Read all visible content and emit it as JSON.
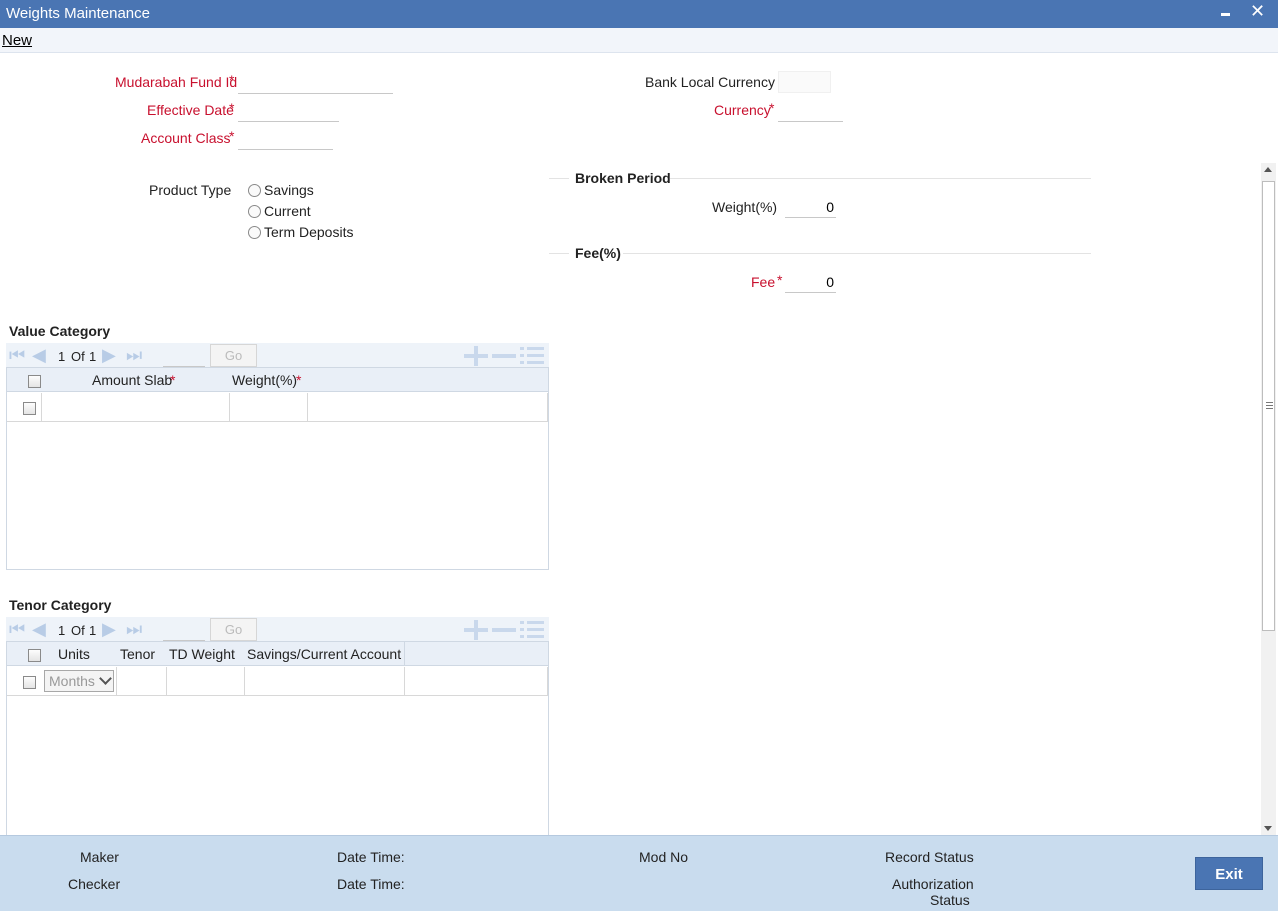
{
  "window": {
    "title": "Weights Maintenance"
  },
  "menu": {
    "new_label": "New"
  },
  "form": {
    "fund_id_label": "Mudarabah Fund Id",
    "effective_date_label": "Effective Date",
    "account_class_label": "Account Class",
    "bank_local_currency_label": "Bank Local Currency",
    "currency_label": "Currency",
    "required_mark": "*",
    "product_type_label": "Product Type",
    "product_types": [
      "Savings",
      "Current",
      "Term Deposits"
    ]
  },
  "broken_period": {
    "title": "Broken Period",
    "weight_label": "Weight(%)",
    "weight_value": "0"
  },
  "fee_section": {
    "title": "Fee(%)",
    "fee_label": "Fee",
    "fee_value": "0"
  },
  "value_category": {
    "title": "Value Category",
    "page_current": "1",
    "page_of": "Of",
    "page_total": "1",
    "go_label": "Go",
    "columns": [
      "Amount Slab",
      "Weight(%)"
    ]
  },
  "tenor_category": {
    "title": "Tenor Category",
    "page_current": "1",
    "page_of": "Of",
    "page_total": "1",
    "go_label": "Go",
    "columns": [
      "Units",
      "Tenor",
      "TD Weight",
      "Savings/Current Account"
    ],
    "units_selected": "Months"
  },
  "footer": {
    "maker_label": "Maker",
    "checker_label": "Checker",
    "date_time_label": "Date Time:",
    "mod_no_label": "Mod No",
    "record_status_label": "Record Status",
    "authorization_label": "Authorization",
    "status_label": "Status",
    "exit_label": "Exit"
  },
  "colors": {
    "titlebar": "#4a75b3",
    "required": "#c8102e",
    "footer": "#c9dcee"
  }
}
